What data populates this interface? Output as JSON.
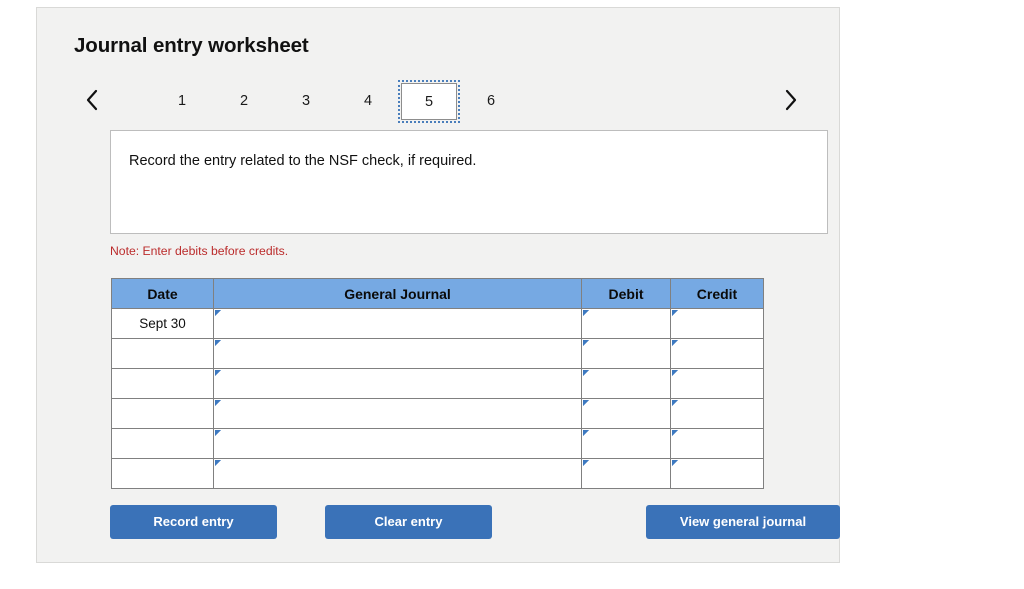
{
  "card": {
    "title": "Journal entry worksheet"
  },
  "nav": {
    "prev_icon": "chevron-left-icon",
    "next_icon": "chevron-right-icon",
    "tabs": [
      {
        "label": "1",
        "selected": false
      },
      {
        "label": "2",
        "selected": false
      },
      {
        "label": "3",
        "selected": false
      },
      {
        "label": "4",
        "selected": false
      },
      {
        "label": "5",
        "selected": true
      },
      {
        "label": "6",
        "selected": false
      }
    ],
    "selected_tab": "5"
  },
  "instruction": {
    "text": "Record the entry related to the NSF check, if required."
  },
  "note": {
    "text": "Note: Enter debits before credits."
  },
  "table": {
    "columns": [
      "Date",
      "General Journal",
      "Debit",
      "Credit"
    ],
    "rows": [
      {
        "date": "Sept 30",
        "general_journal": "",
        "debit": "",
        "credit": ""
      },
      {
        "date": "",
        "general_journal": "",
        "debit": "",
        "credit": ""
      },
      {
        "date": "",
        "general_journal": "",
        "debit": "",
        "credit": ""
      },
      {
        "date": "",
        "general_journal": "",
        "debit": "",
        "credit": ""
      },
      {
        "date": "",
        "general_journal": "",
        "debit": "",
        "credit": ""
      },
      {
        "date": "",
        "general_journal": "",
        "debit": "",
        "credit": ""
      }
    ]
  },
  "buttons": {
    "record": "Record entry",
    "clear": "Clear entry",
    "view": "View general journal"
  },
  "colors": {
    "header_blue": "#76a9e3",
    "button_blue": "#3a72b8",
    "note_red": "#bb2c2c",
    "card_bg": "#f2f2f1",
    "picker_blue": "#3d79c0"
  }
}
